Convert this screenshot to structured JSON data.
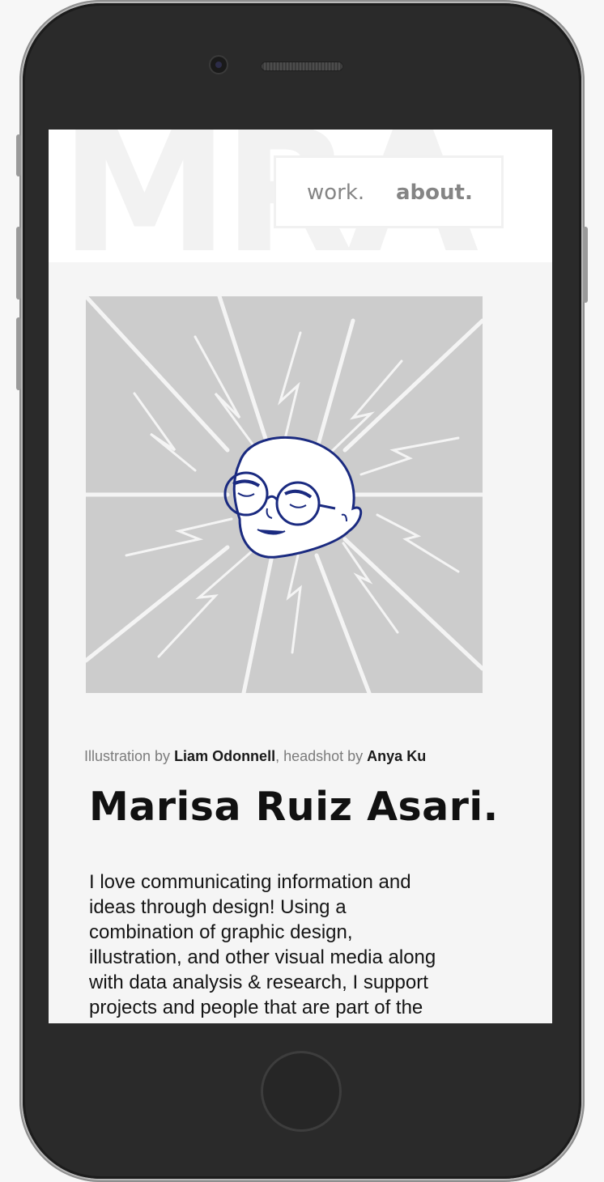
{
  "site": {
    "watermark": "MRA",
    "nav": {
      "work_label": "work.",
      "about_label": "about."
    }
  },
  "about": {
    "credit": {
      "illustration_prefix": "Illustration by ",
      "illustrator": "Liam Odonnell",
      "headshot_prefix": ", headshot by ",
      "photographer": "Anya Ku"
    },
    "name": "Marisa Ruiz Asari.",
    "bio_lines": [
      "I love communicating information and",
      "ideas through design! Using a",
      "combination of graphic design,",
      "illustration, and other visual media along",
      "with data analysis & research, I support",
      "projects and people that are part of the"
    ]
  },
  "colors": {
    "illustration_bg": "#cccccc",
    "ink": "#1a2a80",
    "page_bg": "#f5f5f5",
    "bezel": "#2a2a2a"
  },
  "icons": {
    "camera": "front-camera-icon",
    "speaker": "earpiece-speaker-icon",
    "home": "home-button-icon"
  }
}
